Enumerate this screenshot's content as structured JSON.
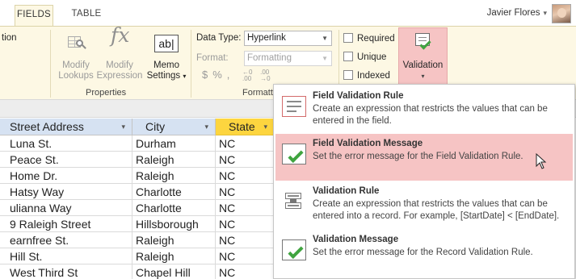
{
  "tabs": [
    {
      "label": "FIELDS",
      "active": true
    },
    {
      "label": "TABLE",
      "active": false
    }
  ],
  "user": {
    "name": "Javier Flores",
    "caret": "▾"
  },
  "ribbon": {
    "cut_left_label": "tion",
    "properties": {
      "group_label": "Properties",
      "modify_lookups": [
        "Modify",
        "Lookups"
      ],
      "modify_expression": [
        "Modify",
        "Expression"
      ],
      "memo_settings": [
        "Memo",
        "Settings"
      ],
      "memo_icon_text": "ab|",
      "fx_glyph": "fx"
    },
    "formatting": {
      "group_label": "Formatt",
      "data_type_label": "Data Type:",
      "data_type_value": "Hyperlink",
      "format_label": "Format:",
      "format_value": "Formatting",
      "currency": "$",
      "percent": "%",
      "comma": ","
    },
    "checks": [
      {
        "label": "Required",
        "checked": false
      },
      {
        "label": "Unique",
        "checked": false
      },
      {
        "label": "Indexed",
        "checked": false
      }
    ],
    "validation": {
      "label": "Validation",
      "caret": "▾",
      "highlight": "#f6c4c4"
    }
  },
  "sheet": {
    "columns": [
      "Street Address",
      "City",
      "State"
    ],
    "rows": [
      [
        "Luna St.",
        "Durham",
        "NC"
      ],
      [
        "Peace St.",
        "Raleigh",
        "NC"
      ],
      [
        "Home Dr.",
        "Raleigh",
        "NC"
      ],
      [
        "Hatsy Way",
        "Charlotte",
        "NC"
      ],
      [
        "ulianna Way",
        "Charlotte",
        "NC"
      ],
      [
        "9 Raleigh Street",
        "Hillsborough",
        "NC"
      ],
      [
        "earnfree St.",
        "Raleigh",
        "NC"
      ],
      [
        "Hill St.",
        "Raleigh",
        "NC"
      ],
      [
        "West Third St",
        "Chapel Hill",
        "NC"
      ]
    ],
    "state_header_color": "#fdd53f"
  },
  "menu": {
    "items": [
      {
        "title": "Field Validation Rule",
        "desc": "Create an expression that restricts the values that can be entered in the field.",
        "icon": "field-validation-rule-icon",
        "highlighted": false
      },
      {
        "title": "Field Validation Message",
        "desc": "Set the error message for the Field Validation Rule.",
        "icon": "field-validation-message-icon",
        "highlighted": true
      },
      {
        "title": "Validation Rule",
        "desc": "Create an expression that restricts the values that can be entered into a record.  For example, [StartDate] < [EndDate].",
        "icon": "validation-rule-icon",
        "highlighted": false
      },
      {
        "title": "Validation Message",
        "desc": "Set the error message for the Record Validation Rule.",
        "icon": "validation-message-icon",
        "highlighted": false
      }
    ]
  }
}
